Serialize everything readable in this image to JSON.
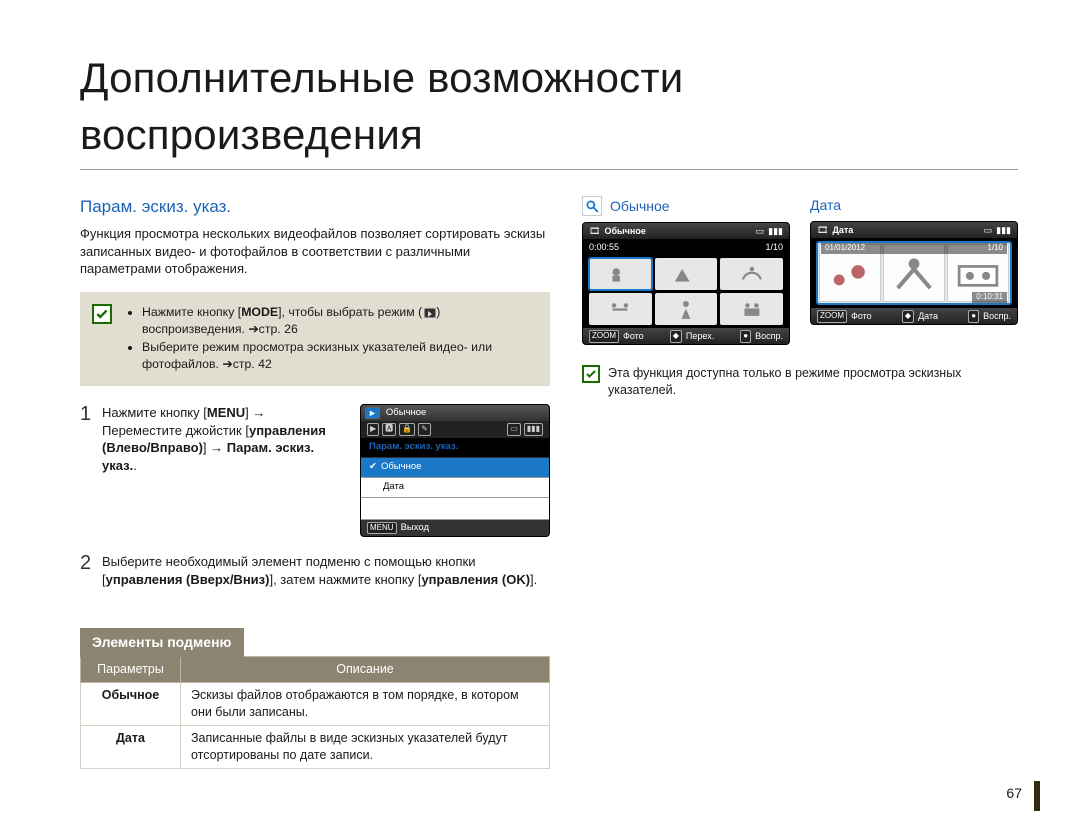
{
  "page": {
    "title": "Дополнительные возможности воспроизведения",
    "number": "67"
  },
  "left": {
    "section_title": "Парам. эскиз. указ.",
    "intro": "Функция просмотра нескольких видеофайлов позволяет сортировать эскизы записанных видео- и фотофайлов в соответствии с различными параметрами отображения.",
    "note_items": {
      "a_pre": "Нажмите кнопку [",
      "a_mode": "MODE",
      "a_mid": "], чтобы выбрать режим (",
      "a_post": ") воспроизведения. ",
      "a_ref": "стр. 26",
      "b_text": "Выберите режим просмотра эскизных указателей видео- или фотофайлов. ",
      "b_ref": "стр. 42"
    },
    "steps": [
      {
        "num": "1",
        "l1_a": "Нажмите кнопку [",
        "l1_menu": "MENU",
        "l1_b": "] → Переместите джойстик [",
        "l1_ctrl": "управления (Влево/Вправо)",
        "l1_c": "] → ",
        "l1_target": "Парам. эскиз. указ.",
        "l1_d": "."
      },
      {
        "num": "2",
        "l2_a": "Выберите необходимый элемент подменю с помощью кнопки [",
        "l2_ctrl": "управления (Вверх/Вниз)",
        "l2_b": "], затем нажмите кнопку [",
        "l2_ok": "управления (OK)",
        "l2_c": "]."
      }
    ],
    "menu_screen": {
      "top_label": "Обычное",
      "header": "Парам. эскиз. указ.",
      "opt_selected": "Обычное",
      "opt_other": "Дата",
      "footer_badge": "MENU",
      "footer_label": "Выход"
    },
    "submenu_title": "Элементы подменю",
    "table": {
      "h1": "Параметры",
      "h2": "Описание",
      "rows": [
        {
          "p": "Обычное",
          "d": "Эскизы файлов отображаются в том порядке, в котором они были записаны."
        },
        {
          "p": "Дата",
          "d": "Записанные файлы в виде эскизных указателей будут отсортированы по дате записи."
        }
      ]
    }
  },
  "right": {
    "previews": [
      {
        "title": "Обычное",
        "show_mag": true,
        "top_text": "Обычное",
        "top_time": "0:00:55",
        "top_count": "1/10",
        "foot": {
          "zoom": "ZOOM",
          "zoom_l": "Фото",
          "nav": "",
          "nav_l": "Перех.",
          "ok": "",
          "ok_l": "Воспр."
        }
      },
      {
        "title": "Дата",
        "show_mag": false,
        "top_text": "Дата",
        "top_date": "01/01/2012",
        "top_count": "1/10",
        "row_time": "0:10:31",
        "foot": {
          "zoom": "ZOOM",
          "zoom_l": "Фото",
          "nav": "",
          "nav_l": "Дата",
          "ok": "",
          "ok_l": "Воспр."
        }
      }
    ],
    "note": "Эта функция доступна только в режиме просмотра эскизных указателей."
  }
}
